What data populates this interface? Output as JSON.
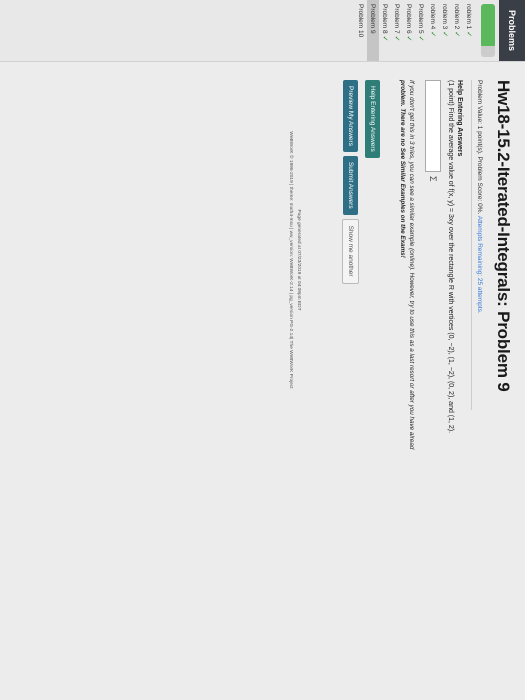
{
  "sidebar": {
    "header": "Problems",
    "progress": 0.8,
    "progress_color": "#5cb85c",
    "items": [
      {
        "label": "roblem 1",
        "check": "✓"
      },
      {
        "label": "roblem 2",
        "check": "✓"
      },
      {
        "label": "roblem 3",
        "check": "✓"
      },
      {
        "label": "roblem 4",
        "check": "✓"
      },
      {
        "label": "Problem 5",
        "check": "✓"
      },
      {
        "label": "Problem 6",
        "check": "✓"
      },
      {
        "label": "Problem 7",
        "check": "✓"
      },
      {
        "label": "Problem 8",
        "check": "✓"
      },
      {
        "label": "Problem 9",
        "check": "",
        "active": true
      },
      {
        "label": "Problem 10",
        "check": ""
      }
    ]
  },
  "main": {
    "title": "Hw18-15.2-Iterated-Integrals: Problem 9",
    "status": {
      "value": "Problem Value: 1 point(s).",
      "score": "Problem Score: 0%.",
      "attempts": "Attempts Remaining: 25 attempts."
    },
    "help_heading": "Help Entering Answers",
    "problem_text": "(1 point) Find the average value of f(x, y) = 3xy over the rectangle R with vertices (0, −2), (1, −2), (0, 2), and (1, 2).",
    "sigma": "Σ",
    "warning_1": "If you don't get this in 3 tries, you can see a similar example (online). However, try to use this as a last resort or after you have alread",
    "warning_2": "problem. There are no See Similar Examples on the Exams!",
    "buttons": {
      "help": "Help Entering Answers",
      "preview": "Preview My Answers",
      "submit": "Submit Answers",
      "show_another": "Show me another"
    },
    "footer_1": "Page generated at 07/23/2019 at 04:09pm EDT",
    "footer_2": "WeBWorK © 1996-2019 | theme: math4-msu | ww_version: WeBWorK-2.14 | pg_version PG-2.14| The WeBWorK Project"
  }
}
